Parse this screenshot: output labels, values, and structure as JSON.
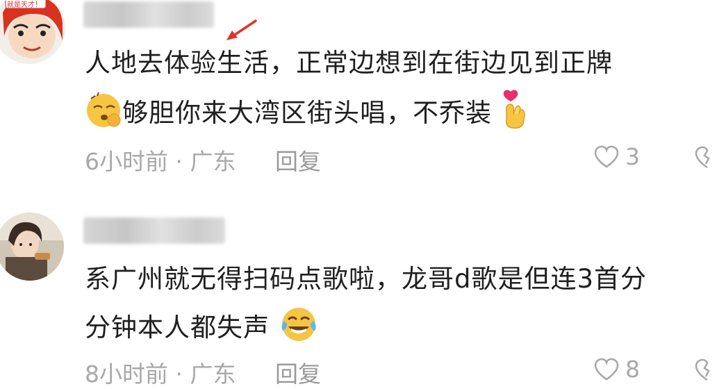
{
  "comments": [
    {
      "avatar_icon": "cartoon-avatar-icon",
      "avatar_badge": "就是天才！",
      "line1": "人地去体验生活，正常边想到在街边见到正牌",
      "line2": "够胆你来大湾区街头唱，不乔装",
      "emoji_before_line2": "sleepy-face-emoji",
      "emoji_after_line2": "finger-heart-emoji",
      "time": "6小时前",
      "location": "广东",
      "reply_label": "回复",
      "like_count": "3"
    },
    {
      "avatar_icon": "photo-avatar-icon",
      "line1": "系广州就无得扫码点歌啦，龙哥d歌是但连3首分",
      "line2": "分钟本人都失声",
      "emoji_after_line2": "tears-of-joy-emoji",
      "time": "8小时前",
      "location": "广东",
      "reply_label": "回复",
      "like_count": "8"
    }
  ],
  "colors": {
    "text": "#1f1f1f",
    "meta": "#a8a8a8",
    "arrow": "#e03224",
    "emoji_yellow": "#f6c544"
  }
}
